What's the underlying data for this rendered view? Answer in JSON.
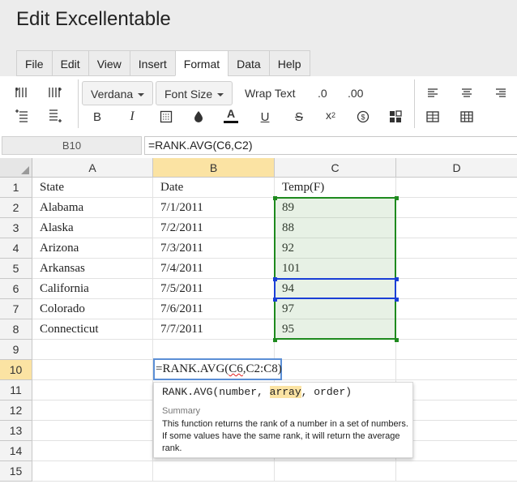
{
  "app": {
    "title": "Edit Excellentable"
  },
  "menu": {
    "tabs": [
      {
        "label": "File"
      },
      {
        "label": "Edit"
      },
      {
        "label": "View"
      },
      {
        "label": "Insert"
      },
      {
        "label": "Format"
      },
      {
        "label": "Data"
      },
      {
        "label": "Help"
      }
    ],
    "active": "Format"
  },
  "toolbar": {
    "font": "Verdana",
    "font_size": "Font Size",
    "wrap_text": "Wrap Text",
    "decrease_decimals": ".0",
    "increase_decimals": ".00",
    "text_color": "#111111"
  },
  "formula_bar": {
    "cell_ref": "B10",
    "formula": "=RANK.AVG(C6,C2)"
  },
  "grid": {
    "columns": [
      "A",
      "B",
      "C",
      "D"
    ],
    "rows": [
      "1",
      "2",
      "3",
      "4",
      "5",
      "6",
      "7",
      "8",
      "9",
      "10",
      "11",
      "12",
      "13",
      "14",
      "15"
    ],
    "selected_column": "B",
    "selected_row": "10",
    "data": [
      [
        "State",
        "Date",
        "Temp(F)"
      ],
      [
        "Alabama",
        "7/1/2011",
        "89"
      ],
      [
        "Alaska",
        "7/2/2011",
        "88"
      ],
      [
        "Arizona",
        "7/3/2011",
        "92"
      ],
      [
        "Arkansas",
        "7/4/2011",
        "101"
      ],
      [
        "California",
        "7/5/2011",
        "94"
      ],
      [
        "Colorado",
        "7/6/2011",
        "97"
      ],
      [
        "Connecticut",
        "7/7/2011",
        "95"
      ]
    ],
    "editing": {
      "prefix": "=RANK.AVG(",
      "squiggle": "C6",
      "suffix": ",C2:C8)"
    },
    "range_color": "#1e8a1e",
    "ref_color": "#1a3fd6",
    "selection_color": "#fbe3a3"
  },
  "tooltip": {
    "fn": "RANK.AVG(",
    "arg1": "number, ",
    "arg2": "array",
    "arg3": ", order)",
    "summary_label": "Summary",
    "description": "This function returns the rank of a number in a set of numbers. If some values have the same rank, it will return the average rank."
  }
}
